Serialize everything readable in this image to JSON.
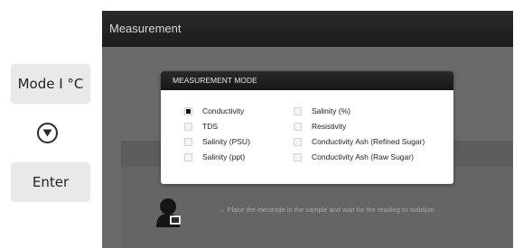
{
  "hardware": {
    "mode_label": "Mode I °C",
    "enter_label": "Enter"
  },
  "screen": {
    "title": "Measurement",
    "hint": "→ Place the electrode in the sample and wait for the reading to stabilize."
  },
  "dialog": {
    "title": "MEASUREMENT MODE",
    "options": [
      {
        "label": "Conductivity",
        "checked": true
      },
      {
        "label": "TDS",
        "checked": false
      },
      {
        "label": "Salinity (PSU)",
        "checked": false
      },
      {
        "label": "Salinity (ppt)",
        "checked": false
      },
      {
        "label": "Salinity (%)",
        "checked": false
      },
      {
        "label": "Resistivity",
        "checked": false
      },
      {
        "label": "Conductivity Ash (Refined Sugar)",
        "checked": false
      },
      {
        "label": "Conductivity Ash (Raw Sugar)",
        "checked": false
      }
    ]
  },
  "colors": {
    "screen_bg": "#6a6a6a",
    "header_bg": "#1c1c1c",
    "button_bg": "#e9e9e9"
  }
}
